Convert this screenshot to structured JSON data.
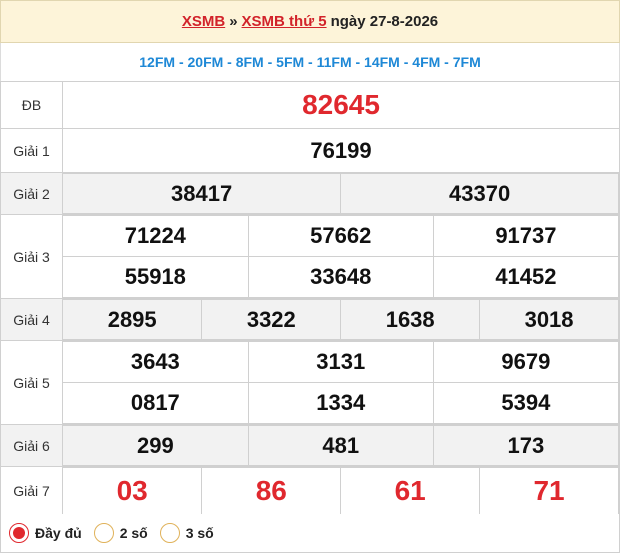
{
  "header": {
    "link1": "XSMB",
    "separator": "»",
    "link2": "XSMB thứ 5",
    "date_text": "ngày 27-8-2026"
  },
  "codes": "12FM - 20FM - 8FM - 5FM - 11FM - 14FM - 4FM - 7FM",
  "prizes": {
    "db": {
      "label": "ĐB",
      "value": "82645"
    },
    "g1": {
      "label": "Giải 1",
      "values": [
        "76199"
      ]
    },
    "g2": {
      "label": "Giải 2",
      "values": [
        "38417",
        "43370"
      ]
    },
    "g3": {
      "label": "Giải 3",
      "values": [
        "71224",
        "57662",
        "91737",
        "55918",
        "33648",
        "41452"
      ]
    },
    "g4": {
      "label": "Giải 4",
      "values": [
        "2895",
        "3322",
        "1638",
        "3018"
      ]
    },
    "g5": {
      "label": "Giải 5",
      "values": [
        "3643",
        "3131",
        "9679",
        "0817",
        "1334",
        "5394"
      ]
    },
    "g6": {
      "label": "Giải 6",
      "values": [
        "299",
        "481",
        "173"
      ]
    },
    "g7": {
      "label": "Giải 7",
      "values": [
        "03",
        "86",
        "61",
        "71"
      ]
    }
  },
  "footer": {
    "options": [
      {
        "label": "Đầy đủ",
        "selected": true
      },
      {
        "label": "2 số",
        "selected": false
      },
      {
        "label": "3 số",
        "selected": false
      }
    ]
  },
  "colors": {
    "accent_red": "#e0282e",
    "code_blue": "#1e88d6",
    "header_bg": "#fdf4d9"
  }
}
